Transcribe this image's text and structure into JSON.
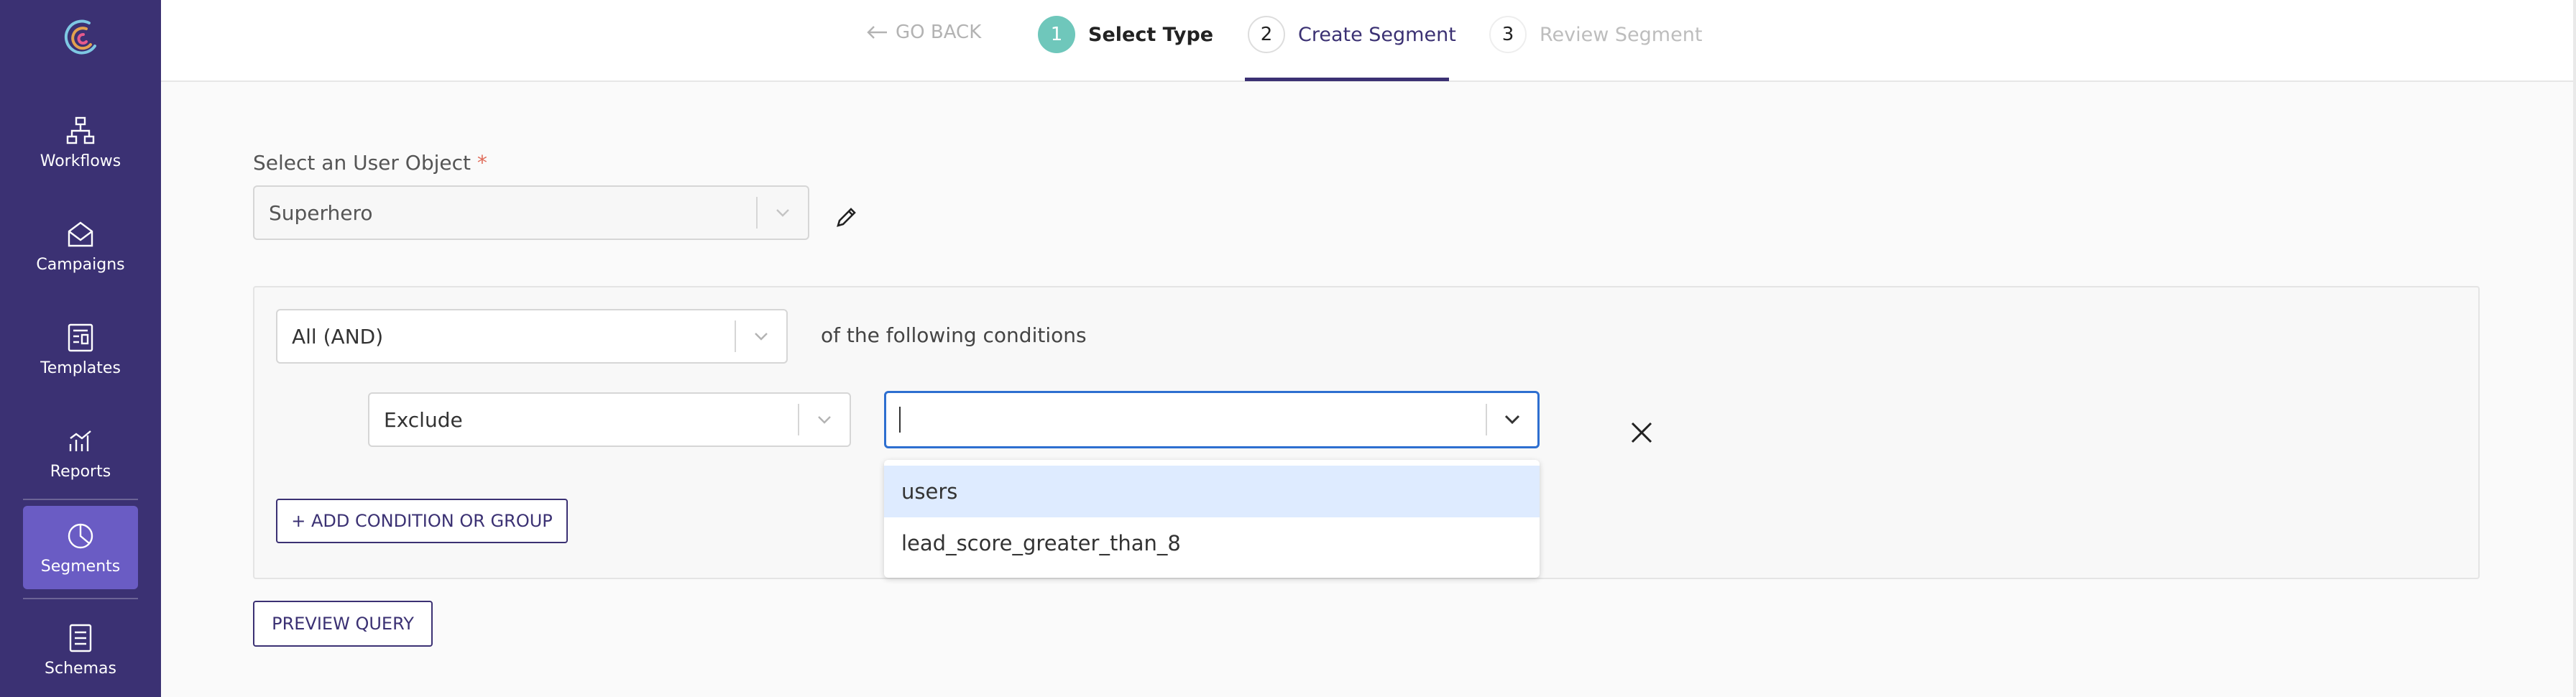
{
  "sidebar": {
    "items": [
      {
        "label": "Workflows",
        "icon": "workflow-icon"
      },
      {
        "label": "Campaigns",
        "icon": "envelope-icon"
      },
      {
        "label": "Templates",
        "icon": "template-icon"
      },
      {
        "label": "Reports",
        "icon": "chart-icon"
      },
      {
        "label": "Segments",
        "icon": "pie-icon",
        "active": true
      },
      {
        "label": "Schemas",
        "icon": "document-icon"
      }
    ],
    "colors": {
      "bg": "#3b3173",
      "active": "#6a5cc4"
    }
  },
  "topbar": {
    "go_back": "GO BACK",
    "steps": [
      {
        "num": "1",
        "label": "Select Type",
        "state": "done"
      },
      {
        "num": "2",
        "label": "Create Segment",
        "state": "current"
      },
      {
        "num": "3",
        "label": "Review Segment",
        "state": "upcoming"
      }
    ]
  },
  "form": {
    "user_object_label": "Select an User Object",
    "required_mark": "*",
    "user_object_value": "Superhero",
    "match_value": "All (AND)",
    "conditions_text": "of the following conditions",
    "include_value": "Exclude",
    "search_value": "",
    "dropdown_options": [
      "users",
      "lead_score_greater_than_8"
    ],
    "add_button": "+ ADD CONDITION OR GROUP",
    "preview_button": "PREVIEW QUERY"
  }
}
